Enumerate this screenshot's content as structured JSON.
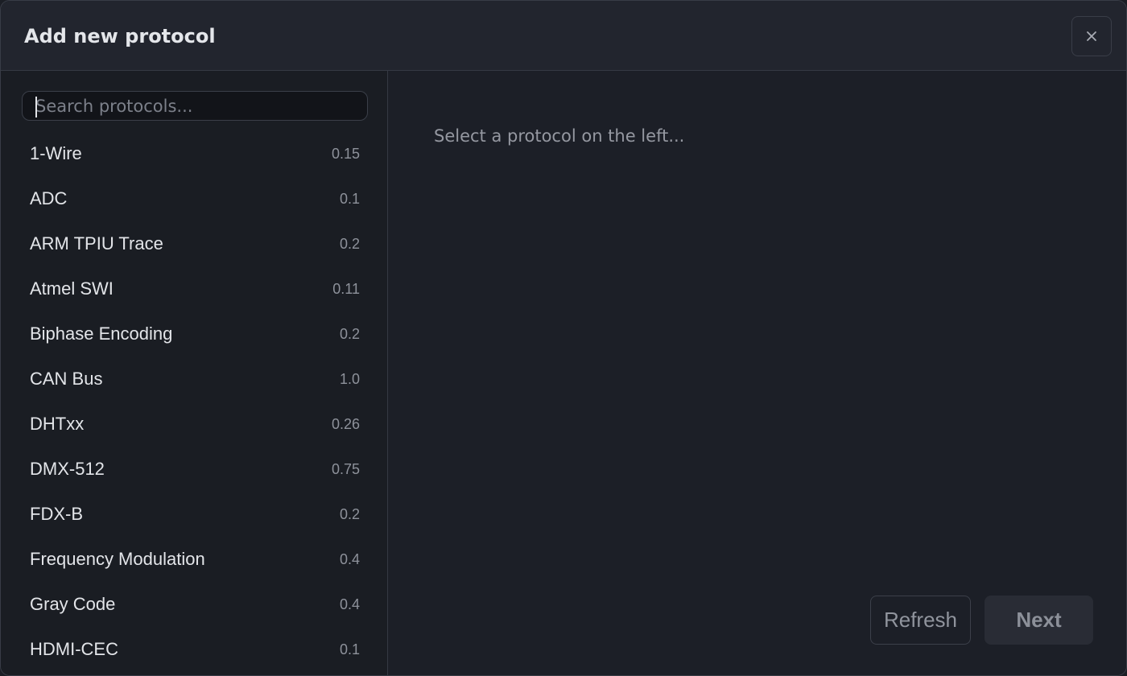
{
  "dialog": {
    "title": "Add new protocol",
    "close_icon": "close-icon"
  },
  "search": {
    "placeholder": "Search protocols...",
    "value": ""
  },
  "protocols": [
    {
      "name": "1-Wire",
      "version": "0.15"
    },
    {
      "name": "ADC",
      "version": "0.1"
    },
    {
      "name": "ARM TPIU Trace",
      "version": "0.2"
    },
    {
      "name": "Atmel SWI",
      "version": "0.11"
    },
    {
      "name": "Biphase Encoding",
      "version": "0.2"
    },
    {
      "name": "CAN Bus",
      "version": "1.0"
    },
    {
      "name": "DHTxx",
      "version": "0.26"
    },
    {
      "name": "DMX-512",
      "version": "0.75"
    },
    {
      "name": "FDX-B",
      "version": "0.2"
    },
    {
      "name": "Frequency Modulation",
      "version": "0.4"
    },
    {
      "name": "Gray Code",
      "version": "0.4"
    },
    {
      "name": "HDMI-CEC",
      "version": "0.1"
    }
  ],
  "detail": {
    "placeholder_text": "Select a protocol on the left..."
  },
  "footer": {
    "refresh_label": "Refresh",
    "next_label": "Next"
  },
  "colors": {
    "background": "#1c1f27",
    "header": "#22252e",
    "sidebar": "#1a1d23",
    "text": "#e3e5e9",
    "muted": "#8e929b"
  }
}
